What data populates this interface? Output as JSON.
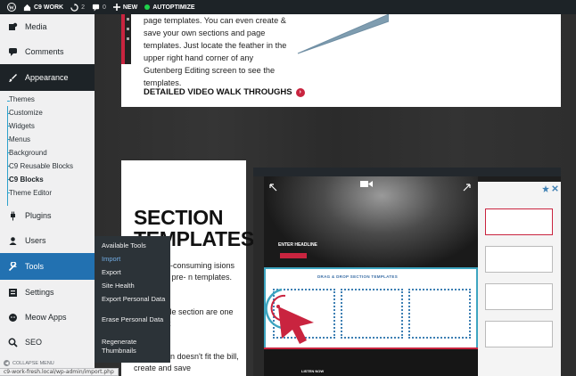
{
  "admin_bar": {
    "site_name": "C9 WORK",
    "updates_count": "2",
    "comments_count": "0",
    "new_label": "NEW",
    "autoptimize_label": "AUTOPTIMIZE"
  },
  "sidebar": {
    "items": [
      {
        "label": "Media",
        "icon": "media-icon"
      },
      {
        "label": "Comments",
        "icon": "comments-icon"
      },
      {
        "label": "Appearance",
        "icon": "brush-icon"
      },
      {
        "label": "Plugins",
        "icon": "plug-icon"
      },
      {
        "label": "Users",
        "icon": "user-icon"
      },
      {
        "label": "Tools",
        "icon": "wrench-icon"
      },
      {
        "label": "Settings",
        "icon": "settings-icon"
      },
      {
        "label": "Meow Apps",
        "icon": "meow-icon"
      },
      {
        "label": "SEO",
        "icon": "search-icon"
      }
    ],
    "appearance_submenu": [
      "Themes",
      "Customize",
      "Widgets",
      "Menus",
      "Background",
      "C9 Reusable Blocks",
      "C9 Blocks",
      "Theme Editor"
    ],
    "collapse_label": "COLLAPSE MENU"
  },
  "tools_flyout": [
    "Available Tools",
    "Import",
    "Export",
    "Site Health",
    "Export Personal Data",
    "Erase Personal Data",
    "Regenerate Thumbnails"
  ],
  "content": {
    "card1_text": "page templates. You can even create & save your own sections and page templates. Just locate the feather in the upper right hand corner of any Gutenberg Editing screen to see the templates.",
    "card1_link": "DETAILED VIDEO WALK THROUGHS",
    "section_title_1": "SECTION",
    "section_title_2": "TEMPLATES",
    "para_a": "time-consuming isions with pre- n templates.",
    "para_b": "izable section are one click",
    "para_c": "ade section doesn't fit the bill, create and save",
    "mock_headline": "ENTER HEADLINE",
    "mock_dd_title": "DRAG & DROP SECTION TEMPLATES",
    "mock_listen": "LISTEN NOW"
  },
  "status_url": "c9-work-fresh.local/wp-admin/import.php"
}
